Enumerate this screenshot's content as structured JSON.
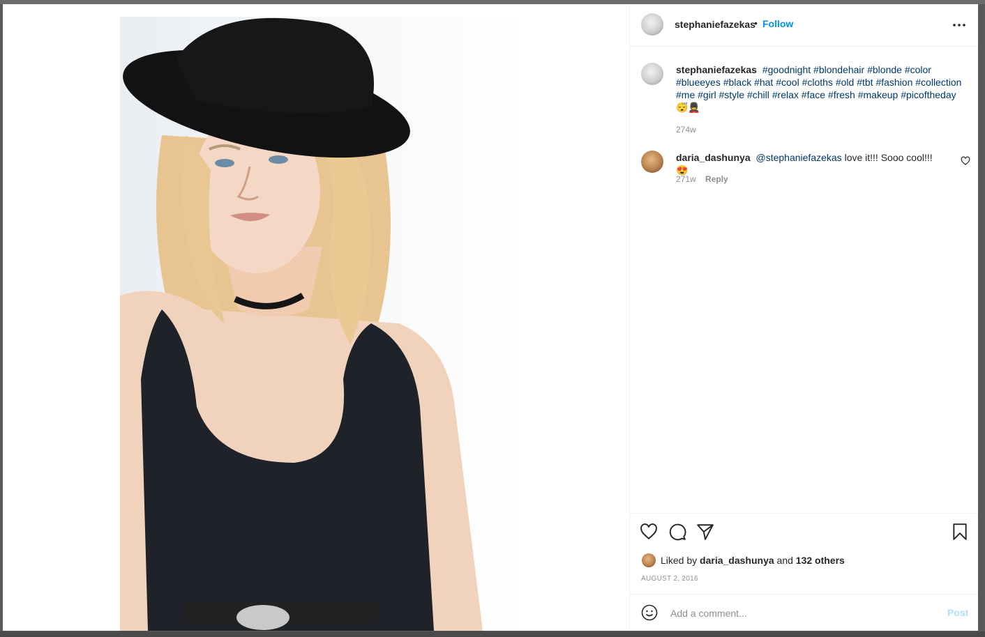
{
  "post": {
    "author": "stephaniefazekas",
    "follow_label": "Follow",
    "separator": "•",
    "more_label": "•••"
  },
  "caption": {
    "username": "stephaniefazekas",
    "tags": [
      "#goodnight",
      "#blondehair",
      "#blonde",
      "#color",
      "#blueeyes",
      "#black",
      "#hat",
      "#cool",
      "#cloths",
      "#old",
      "#tbt",
      "#fashion",
      "#collection",
      "#me",
      "#girl",
      "#style",
      "#chill",
      "#relax",
      "#face",
      "#fresh",
      "#makeup",
      "#picoftheday"
    ],
    "emojis": "😴💂",
    "time": "274w"
  },
  "comment": {
    "username": "daria_dashunya",
    "mention": "@stephaniefazekas",
    "text": "love it!!! Sooo cool!!!",
    "emoji": "😍",
    "time": "271w",
    "reply_label": "Reply"
  },
  "likes": {
    "prefix": "Liked by",
    "user": "daria_dashunya",
    "middle": "and",
    "others": "132 others"
  },
  "date": "AUGUST 2, 2016",
  "add_comment": {
    "placeholder": "Add a comment...",
    "post_label": "Post"
  },
  "colors": {
    "link": "#0095f6",
    "hashtag": "#00376b",
    "muted": "#8e8e8e",
    "post_disabled": "#b2dffc"
  },
  "icons": {
    "like": "heart-icon",
    "comment": "speech-bubble-icon",
    "share": "paper-plane-icon",
    "save": "bookmark-icon",
    "emoji": "smiley-icon",
    "more": "more-options-icon"
  }
}
